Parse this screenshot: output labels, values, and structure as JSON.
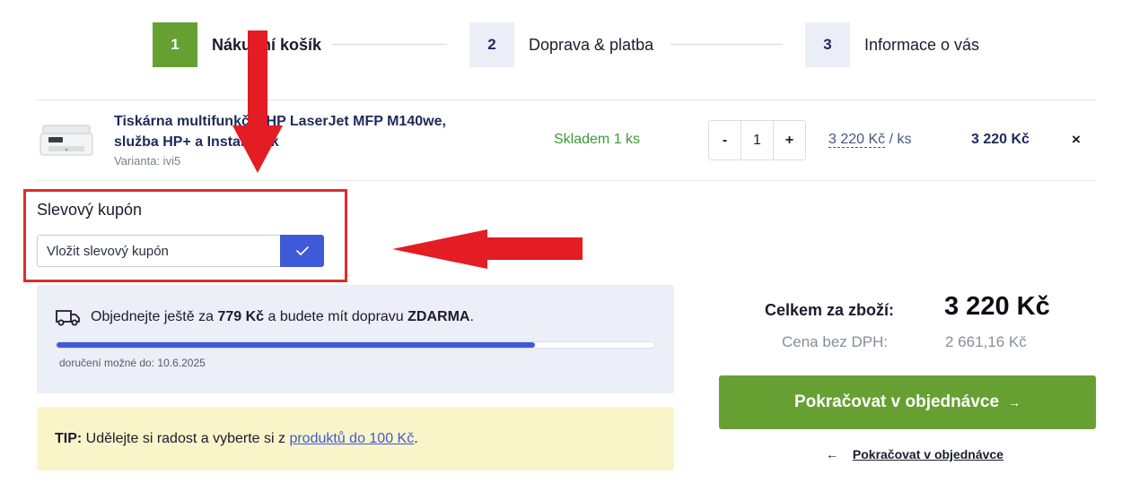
{
  "steps": [
    {
      "number": "1",
      "label": "Nákupní košík"
    },
    {
      "number": "2",
      "label": "Doprava & platba"
    },
    {
      "number": "3",
      "label": "Informace o vás"
    }
  ],
  "cart_item": {
    "name": "Tiskárna multifunkční HP LaserJet MFP M140we, služba HP+ a Instant Ink",
    "variant": "Varianta: ivi5",
    "stock": "Skladem 1 ks",
    "qty_minus": "-",
    "qty_value": "1",
    "qty_plus": "+",
    "unit_price": "3 220 Kč",
    "unit_suffix": "/ ks",
    "total": "3 220 Kč",
    "remove": "×"
  },
  "coupon": {
    "title": "Slevový kupón",
    "placeholder": "Vložit slevový kupón"
  },
  "shipping": {
    "text_prefix": "Objednejte ještě za",
    "amount": "779 Kč",
    "text_middle": "a budete mít dopravu",
    "free": "ZDARMA",
    "text_suffix": ".",
    "progress": 0.8,
    "delivery": "doručení možné do: 10.6.2025"
  },
  "tip": {
    "label": "TIP:",
    "text": "Udělejte si radost a vyberte si z",
    "link": "produktů do 100 Kč",
    "suffix": "."
  },
  "totals": {
    "goods_label": "Celkem za zboží:",
    "goods_value": "3 220 Kč",
    "nett_label": "Cena bez DPH:",
    "nett_value": "2 661,16 Kč"
  },
  "actions": {
    "continue": "Pokračovat v objednávce",
    "continue_arrow": "→",
    "continue_link": "Pokračovat v objednávce",
    "continue_link_arrow": "←"
  },
  "colors": {
    "accent_green": "#66a032",
    "accent_blue": "#3f5ad8",
    "annotation_red": "#e02b2b"
  }
}
